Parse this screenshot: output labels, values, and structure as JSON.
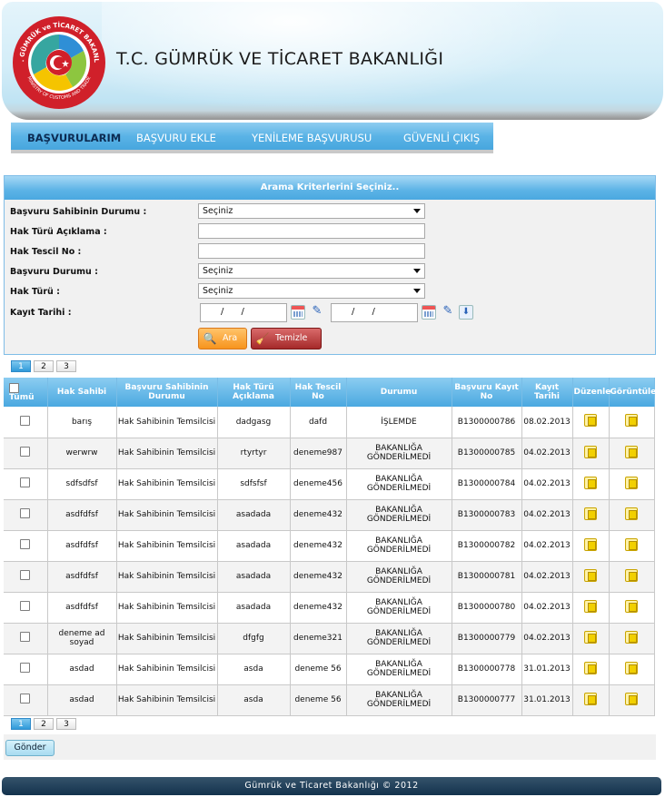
{
  "header": {
    "title": "T.C. GÜMRÜK VE TİCARET BAKANLIĞI",
    "logo_text_top": "T.C. GÜMRÜK ve TİCARET BAKANLIĞI",
    "logo_text_bottom": "MINISTRY OF CUSTOMS AND TRADE"
  },
  "nav": {
    "items": [
      "BAŞVURULARIM",
      "BAŞVURU EKLE",
      "YENİLEME BAŞVURUSU",
      "GÜVENLİ ÇIKIŞ"
    ]
  },
  "search": {
    "title": "Arama Kriterlerini Seçiniz..",
    "labels": {
      "owner_status": "Başvuru Sahibinin Durumu :",
      "right_desc": "Hak Türü Açıklama :",
      "reg_no": "Hak Tescil No :",
      "app_status": "Başvuru Durumu :",
      "right_type": "Hak Türü :",
      "reg_date": "Kayıt Tarihi :"
    },
    "selects": {
      "owner_status": "Seçiniz",
      "app_status": "Seçiniz",
      "right_type": "Seçiniz"
    },
    "date_from": "/ /",
    "date_to": "/ /",
    "search_button": "Ara",
    "clear_button": "Temizle"
  },
  "pager": {
    "pages": [
      "1",
      "2",
      "3"
    ],
    "current": "1"
  },
  "table": {
    "headers": [
      "Tümü",
      "Hak Sahibi",
      "Başvuru Sahibinin Durumu",
      "Hak Türü Açıklama",
      "Hak Tescil No",
      "Durumu",
      "Başvuru Kayıt No",
      "Kayıt Tarihi",
      "Düzenle",
      "Görüntüle"
    ],
    "rows": [
      {
        "owner": "barış",
        "role": "Hak Sahibinin Temsilcisi",
        "desc": "dadgasg",
        "reg": "dafd",
        "status": "İŞLEMDE",
        "app_no": "B1300000786",
        "date": "08.02.2013"
      },
      {
        "owner": "werwrw",
        "role": "Hak Sahibinin Temsilcisi",
        "desc": "rtyrtyr",
        "reg": "deneme987",
        "status": "BAKANLIĞA GÖNDERİLMEDİ",
        "app_no": "B1300000785",
        "date": "04.02.2013"
      },
      {
        "owner": "sdfsdfsf",
        "role": "Hak Sahibinin Temsilcisi",
        "desc": "sdfsfsf",
        "reg": "deneme456",
        "status": "BAKANLIĞA GÖNDERİLMEDİ",
        "app_no": "B1300000784",
        "date": "04.02.2013"
      },
      {
        "owner": "asdfdfsf",
        "role": "Hak Sahibinin Temsilcisi",
        "desc": "asadada",
        "reg": "deneme432",
        "status": "BAKANLIĞA GÖNDERİLMEDİ",
        "app_no": "B1300000783",
        "date": "04.02.2013"
      },
      {
        "owner": "asdfdfsf",
        "role": "Hak Sahibinin Temsilcisi",
        "desc": "asadada",
        "reg": "deneme432",
        "status": "BAKANLIĞA GÖNDERİLMEDİ",
        "app_no": "B1300000782",
        "date": "04.02.2013"
      },
      {
        "owner": "asdfdfsf",
        "role": "Hak Sahibinin Temsilcisi",
        "desc": "asadada",
        "reg": "deneme432",
        "status": "BAKANLIĞA GÖNDERİLMEDİ",
        "app_no": "B1300000781",
        "date": "04.02.2013"
      },
      {
        "owner": "asdfdfsf",
        "role": "Hak Sahibinin Temsilcisi",
        "desc": "asadada",
        "reg": "deneme432",
        "status": "BAKANLIĞA GÖNDERİLMEDİ",
        "app_no": "B1300000780",
        "date": "04.02.2013"
      },
      {
        "owner": "deneme ad soyad",
        "role": "Hak Sahibinin Temsilcisi",
        "desc": "dfgfg",
        "reg": "deneme321",
        "status": "BAKANLIĞA GÖNDERİLMEDİ",
        "app_no": "B1300000779",
        "date": "04.02.2013"
      },
      {
        "owner": "asdad",
        "role": "Hak Sahibinin Temsilcisi",
        "desc": "asda",
        "reg": "deneme 56",
        "status": "BAKANLIĞA GÖNDERİLMEDİ",
        "app_no": "B1300000778",
        "date": "31.01.2013"
      },
      {
        "owner": "asdad",
        "role": "Hak Sahibinin Temsilcisi",
        "desc": "asda",
        "reg": "deneme 56",
        "status": "BAKANLIĞA GÖNDERİLMEDİ",
        "app_no": "B1300000777",
        "date": "31.01.2013"
      }
    ]
  },
  "submit_button": "Gönder",
  "footer": "Gümrük ve Ticaret Bakanlığı © 2012",
  "colors": {
    "accent": "#4aa8e0",
    "footer": "#13324d",
    "search_btn": "#f7941d",
    "clear_btn": "#a52a2a"
  }
}
